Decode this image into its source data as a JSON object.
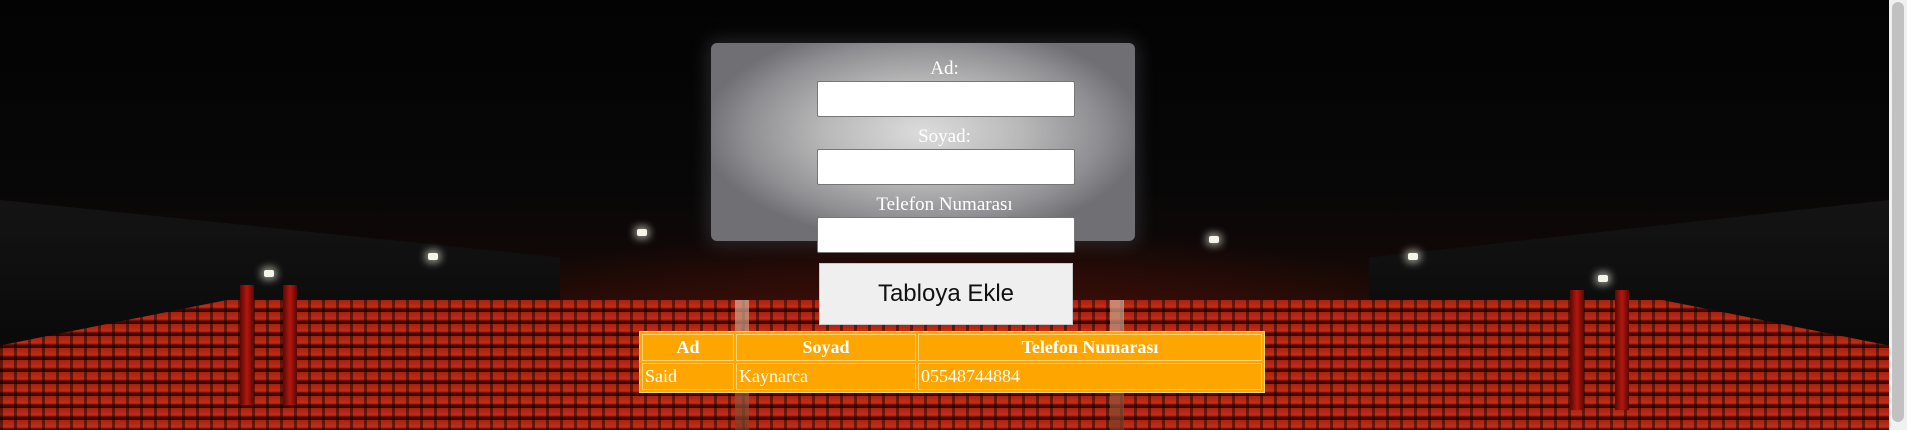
{
  "form": {
    "first_name_label": "Ad:",
    "first_name_value": "",
    "last_name_label": "Soyad:",
    "last_name_value": "",
    "phone_label": "Telefon Numarası",
    "phone_value": "",
    "submit_label": "Tabloya Ekle"
  },
  "table": {
    "headers": [
      "Ad",
      "Soyad",
      "Telefon Numarası"
    ],
    "rows": [
      [
        "Said",
        "Kaynarca",
        "05548744884"
      ]
    ]
  },
  "colors": {
    "table_background": "#ffa500",
    "button_background": "#efefef",
    "label_text": "#ffffff"
  }
}
